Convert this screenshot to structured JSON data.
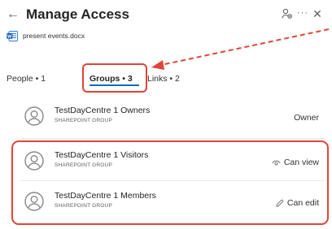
{
  "header": {
    "back_icon": "arrow-left-icon",
    "back_glyph": "←",
    "title": "Manage Access",
    "icons": [
      "share-people-icon",
      "more-options-icon",
      "close-icon"
    ]
  },
  "file": {
    "icon": "word-doc-icon",
    "name": "present events.docx"
  },
  "tabs": [
    {
      "label": "People • 1"
    },
    {
      "label": "Groups • 3",
      "selected": true
    },
    {
      "label": "Links • 2"
    }
  ],
  "groups": [
    {
      "name": "TestDayCentre 1 Owners",
      "type": "SHAREPOINT GROUP",
      "permission": "Owner",
      "permission_icon": ""
    },
    {
      "name": "TestDayCentre 1 Visitors",
      "type": "SHAREPOINT GROUP",
      "permission": "Can view",
      "permission_icon": "eye-icon"
    },
    {
      "name": "TestDayCentre 1 Members",
      "type": "SHAREPOINT GROUP",
      "permission": "Can edit",
      "permission_icon": "pencil-icon"
    }
  ],
  "colors": {
    "accent": "#0f6cbd",
    "annotation": "#e0443a",
    "word_blue": "#185abd"
  }
}
